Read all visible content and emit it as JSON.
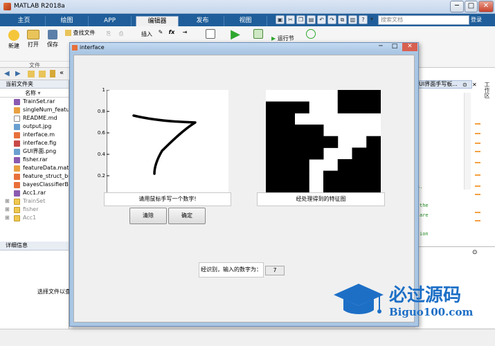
{
  "window": {
    "title": "MATLAB R2018a",
    "minimize": "─",
    "maximize": "□",
    "close": "✕"
  },
  "tabs": [
    {
      "label": "主页"
    },
    {
      "label": "绘图"
    },
    {
      "label": "APP"
    },
    {
      "label": "编辑器"
    },
    {
      "label": "发布"
    },
    {
      "label": "视图"
    }
  ],
  "active_tab": "编辑器",
  "search": {
    "placeholder": "搜索文档",
    "login": "登录"
  },
  "ribbon": {
    "new": "新建",
    "open": "打开",
    "save": "保存",
    "find_files": "查找文件",
    "insert": "插入",
    "fx": "fx",
    "run_section": "运行节",
    "file_group": "文件"
  },
  "nav": {
    "path_suffix": "gnition-master"
  },
  "current_folder": {
    "title": "当前文件夹",
    "column_name": "名称",
    "files": [
      {
        "name": "TrainSet.rar",
        "icon": "rar-icon"
      },
      {
        "name": "singleNum_featu",
        "icon": "mat-icon"
      },
      {
        "name": "README.md",
        "icon": "text-icon"
      },
      {
        "name": "output.jpg",
        "icon": "image-icon"
      },
      {
        "name": "interface.m",
        "icon": "m-file-icon"
      },
      {
        "name": "interface.fig",
        "icon": "fig-icon"
      },
      {
        "name": "GUI界面.png",
        "icon": "image-icon"
      },
      {
        "name": "fisher.rar",
        "icon": "rar-icon"
      },
      {
        "name": "featureData.mat",
        "icon": "mat-icon"
      },
      {
        "name": "feature_struct_bu",
        "icon": "m-file-icon"
      },
      {
        "name": "bayesClassifierB",
        "icon": "m-file-icon"
      },
      {
        "name": "Acc1.rar",
        "icon": "rar-icon"
      }
    ],
    "folders": [
      {
        "name": "TrainSet"
      },
      {
        "name": "fisher"
      },
      {
        "name": "Acc1"
      }
    ]
  },
  "details": {
    "title": "详细信息",
    "message": "选择文件以查"
  },
  "editor_right": {
    "tab_title": "UI界面手写板...",
    "workspace": "工作区",
    "code_fragments": [
      "s.",
      "the",
      "are",
      "ion"
    ]
  },
  "figure": {
    "title": "interface",
    "axes1_ticks": [
      "1",
      "0.8",
      "0.6",
      "0.4",
      "0.2"
    ],
    "axes1_label": "请用鼠标手写一个数字!",
    "axes2_label": "经处理得到的特征图",
    "clear_button": "清除",
    "ok_button": "确定",
    "result_label": "经识别，输入的数字为：",
    "result_value": "7"
  },
  "feature_map": [
    [
      0,
      0,
      0,
      0,
      0,
      1,
      1,
      1
    ],
    [
      1,
      1,
      1,
      0,
      0,
      1,
      1,
      1
    ],
    [
      1,
      1,
      0,
      0,
      0,
      0,
      0,
      0
    ],
    [
      1,
      1,
      1,
      1,
      0,
      0,
      0,
      0
    ],
    [
      1,
      1,
      1,
      1,
      1,
      0,
      0,
      1
    ],
    [
      1,
      1,
      1,
      1,
      0,
      0,
      1,
      1
    ],
    [
      1,
      1,
      1,
      0,
      0,
      1,
      1,
      1
    ],
    [
      1,
      1,
      1,
      0,
      1,
      1,
      1,
      1
    ],
    [
      1,
      1,
      1,
      0,
      1,
      1,
      1,
      1
    ]
  ],
  "watermark": {
    "brand": "必过源码",
    "url": "Biguo100.com"
  },
  "colors": {
    "tabbar": "#1f5e9a",
    "watermark_blue": "#1d6fc6"
  }
}
